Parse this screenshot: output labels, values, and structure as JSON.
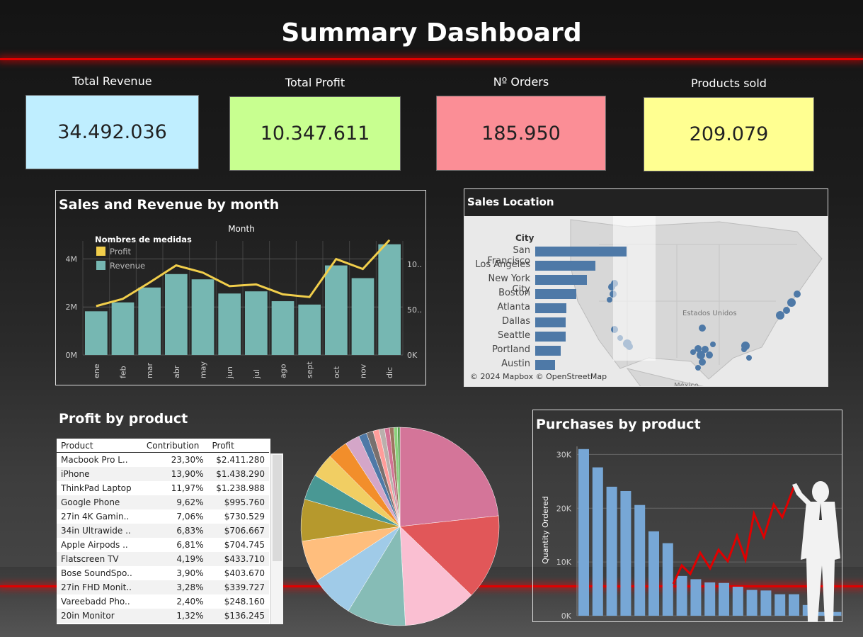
{
  "dashboard": {
    "title": "Summary Dashboard"
  },
  "kpis": [
    {
      "label": "Total Revenue",
      "value": "34.492.036",
      "color": "#bfeeff"
    },
    {
      "label": "Total Profit",
      "value": "10.347.611",
      "color": "#c8ff90"
    },
    {
      "label": "Nº Orders",
      "value": "185.950",
      "color": "#fb8e96"
    },
    {
      "label": "Products sold",
      "value": "209.079",
      "color": "#ffff91"
    }
  ],
  "chart_data": [
    {
      "type": "bar",
      "title": "Sales and Revenue by month",
      "xlabel": "Month",
      "legend_title": "Nombres de medidas",
      "legend_position": "top-left",
      "categories": [
        "ene",
        "feb",
        "mar",
        "abr",
        "may",
        "jun",
        "jul",
        "ago",
        "sept",
        "oct",
        "nov",
        "dic"
      ],
      "series": [
        {
          "name": "Revenue",
          "kind": "bar",
          "axis": "left",
          "color": "#76b7b2",
          "values": [
            1.82,
            2.19,
            2.81,
            3.37,
            3.15,
            2.56,
            2.65,
            2.24,
            2.1,
            3.73,
            3.2,
            4.61
          ]
        },
        {
          "name": "Profit",
          "kind": "line",
          "axis": "right",
          "color": "#f1ce4b",
          "values": [
            54,
            62,
            80,
            99,
            91,
            76,
            78,
            67,
            64,
            106,
            95,
            127
          ]
        }
      ],
      "left_axis": {
        "ticks": [
          "0M",
          "2M",
          "4M"
        ],
        "ylim": [
          0,
          4.75
        ],
        "unit": "M"
      },
      "right_axis": {
        "ticks": [
          "0K",
          "50..",
          "10.."
        ],
        "ylim": [
          0,
          126
        ]
      },
      "grid": true
    },
    {
      "type": "bar",
      "orientation": "horizontal",
      "title": "Sales Location",
      "axis_label": "City",
      "categories": [
        "San Francisco",
        "Los Angeles",
        "New York City",
        "Boston",
        "Atlanta",
        "Dallas",
        "Seattle",
        "Portland",
        "Austin"
      ],
      "values": [
        8.26,
        5.45,
        4.65,
        3.7,
        2.8,
        2.77,
        2.75,
        2.32,
        1.82
      ],
      "color": "#4e79a7",
      "background": "map",
      "map_attribution": "© 2024 Mapbox © OpenStreetMap",
      "map_labels": [
        "Estados Unidos",
        "México"
      ]
    },
    {
      "type": "table",
      "title": "Profit by product",
      "columns": [
        "Product",
        "Contribution",
        "Profit"
      ],
      "rows": [
        [
          "Macbook Pro L..",
          "23,30%",
          "$2.411.280"
        ],
        [
          "iPhone",
          "13,90%",
          "$1.438.290"
        ],
        [
          "ThinkPad Laptop",
          "11,97%",
          "$1.238.988"
        ],
        [
          "Google Phone",
          "9,62%",
          "$995.760"
        ],
        [
          "27in 4K Gamin..",
          "7,06%",
          "$730.529"
        ],
        [
          "34in Ultrawide ..",
          "6,83%",
          "$706.667"
        ],
        [
          "Apple Airpods ..",
          "6,81%",
          "$704.745"
        ],
        [
          "Flatscreen TV",
          "4,19%",
          "$433.710"
        ],
        [
          "Bose SoundSpo..",
          "3,90%",
          "$403.670"
        ],
        [
          "27in FHD Monit..",
          "3,28%",
          "$339.727"
        ],
        [
          "Vareebadd Pho..",
          "2,40%",
          "$248.160"
        ],
        [
          "20in Monitor",
          "1,32%",
          "$136.245"
        ]
      ]
    },
    {
      "type": "pie",
      "values": [
        23.3,
        13.9,
        11.97,
        9.62,
        7.06,
        6.83,
        6.81,
        4.19,
        3.9,
        3.28,
        2.4,
        1.32,
        1.1,
        1.0,
        0.9,
        0.8,
        0.7,
        0.6,
        0.4
      ],
      "colors": [
        "#d47599",
        "#e15759",
        "#fabfd2",
        "#86bcb6",
        "#a0cbe8",
        "#ffbe7d",
        "#b6992d",
        "#499894",
        "#f1ce63",
        "#f28e2b",
        "#d4a6c8",
        "#4e79a7",
        "#79706e",
        "#ff9d9a",
        "#bab0ac",
        "#d37295",
        "#9d7660",
        "#8cd17d",
        "#59a14f"
      ]
    },
    {
      "type": "bar",
      "title": "Purchases by product",
      "ylabel": "Quantity Ordered",
      "y_ticks": [
        "0K",
        "10K",
        "20K",
        "30K"
      ],
      "ylim": [
        0,
        31500
      ],
      "values": [
        31000,
        27600,
        24000,
        23200,
        20600,
        15700,
        13500,
        7400,
        6800,
        6200,
        6100,
        5400,
        4800,
        4700,
        4000,
        4000,
        2000,
        700,
        700
      ],
      "color": "#77a7d6",
      "grid": true
    }
  ]
}
